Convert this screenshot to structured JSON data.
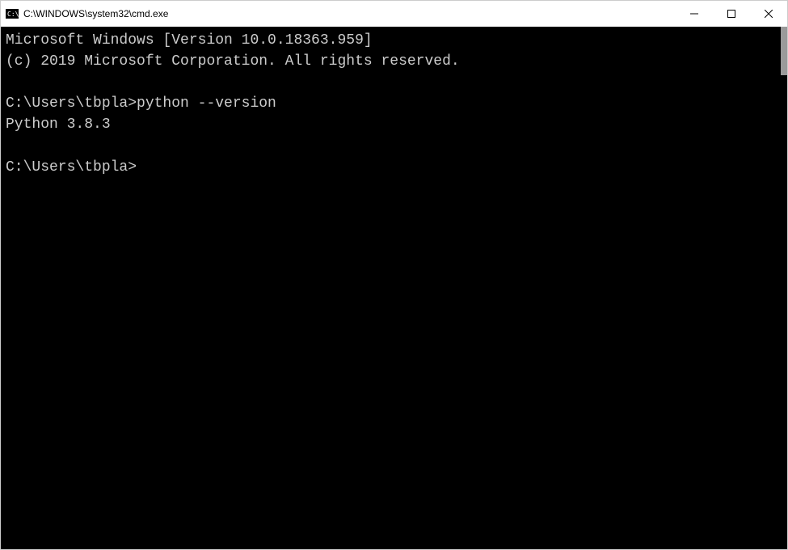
{
  "titlebar": {
    "title": "C:\\WINDOWS\\system32\\cmd.exe"
  },
  "terminal": {
    "line1": "Microsoft Windows [Version 10.0.18363.959]",
    "line2": "(c) 2019 Microsoft Corporation. All rights reserved.",
    "prompt1": "C:\\Users\\tbpla>",
    "command1": "python --version",
    "output1": "Python 3.8.3",
    "prompt2": "C:\\Users\\tbpla>"
  }
}
